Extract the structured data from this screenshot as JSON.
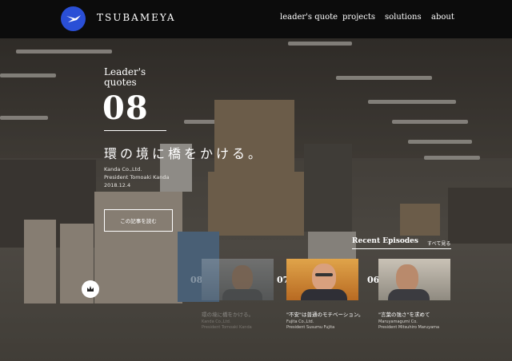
{
  "brand": {
    "name": "TSUBAMEYA",
    "accent": "#2a4fd6"
  },
  "nav": {
    "items": [
      "leader's quote",
      "projects",
      "solutions",
      "about"
    ]
  },
  "hero": {
    "label_line1": "Leader's",
    "label_line2": "quotes",
    "number": "08",
    "title": "環の境に橋をかける。",
    "company": "Kanda Co.,Ltd.",
    "person": "President Tomoaki Kanda",
    "date": "2018.12.4",
    "read_button": "この記事を読む"
  },
  "recent": {
    "heading": "Recent Episodes",
    "see_all": "すべて見る",
    "cards": [
      {
        "num": "08",
        "title": "環の境に橋をかける。",
        "company": "Kanda Co.,Ltd.",
        "person": "President Tomoaki Kanda"
      },
      {
        "num": "07",
        "title": "\"不安\"は普通のモチベーション。",
        "company": "Fujita Co.,Ltd.",
        "person": "President Susumu Fujita"
      },
      {
        "num": "06",
        "title": "\"言葉の強さ\"を求めて",
        "company": "Maruyamagumi Co.",
        "person": "President Mitsuhiro Maruyama"
      }
    ]
  },
  "icons": {
    "logo": "swallow-logo-icon",
    "badge": "crown-badge-icon"
  }
}
